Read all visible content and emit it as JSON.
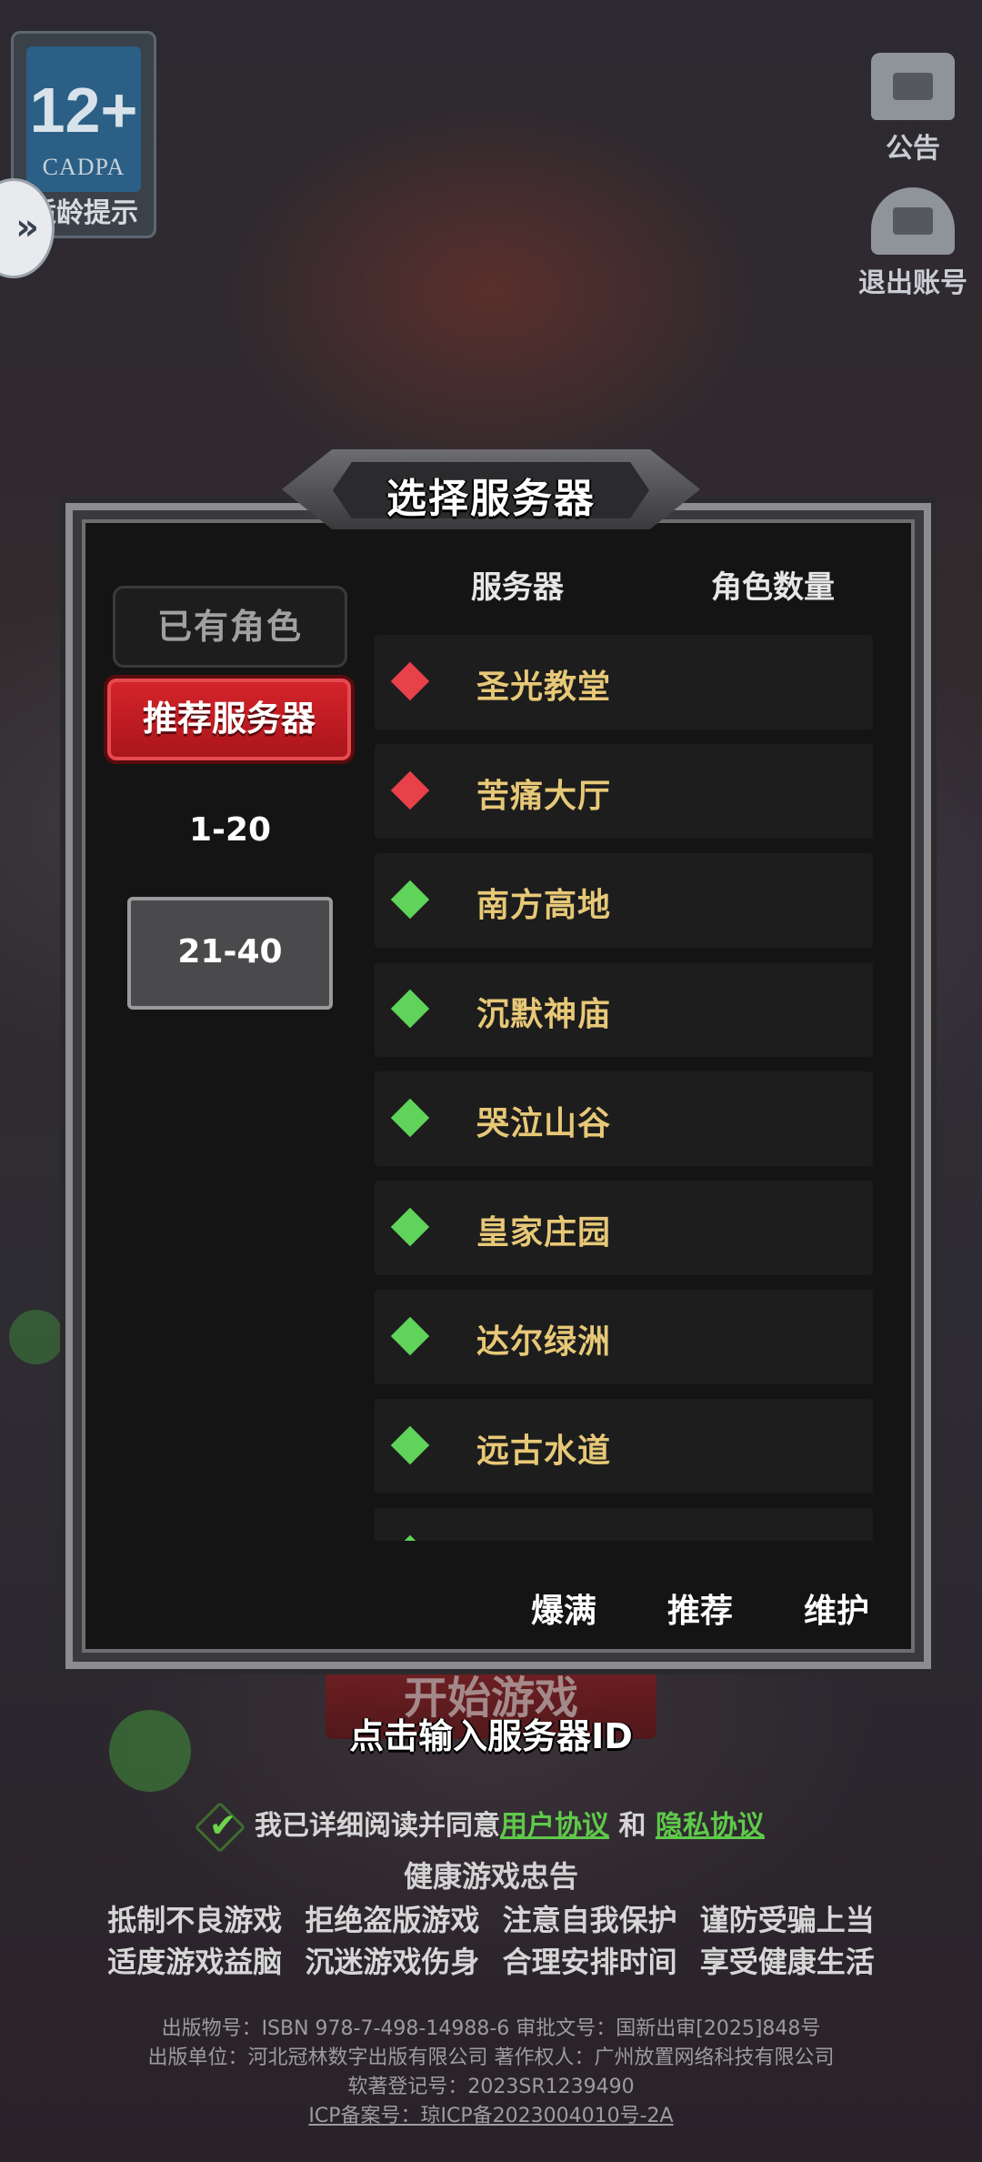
{
  "age_rating": {
    "number": "12+",
    "org": "CADPA",
    "caption": "适龄提示"
  },
  "side_handle_icon": "double-chevron-right-icon",
  "top_right": [
    {
      "label": "公告",
      "icon": "announcement-icon"
    },
    {
      "label": "退出账号",
      "icon": "logout-icon"
    }
  ],
  "dialog": {
    "title": "选择服务器",
    "columns": {
      "server": "服务器",
      "roles": "角色数量"
    },
    "tabs": {
      "owned": "已有角色",
      "recommended": "推荐服务器"
    },
    "ranges": [
      "1-20",
      "21-40"
    ],
    "servers": [
      {
        "name": "圣光教堂",
        "status": "red"
      },
      {
        "name": "苦痛大厅",
        "status": "red"
      },
      {
        "name": "南方高地",
        "status": "green"
      },
      {
        "name": "沉默神庙",
        "status": "green"
      },
      {
        "name": "哭泣山谷",
        "status": "green"
      },
      {
        "name": "皇家庄园",
        "status": "green"
      },
      {
        "name": "达尔绿洲",
        "status": "green"
      },
      {
        "name": "远古水道",
        "status": "green"
      }
    ],
    "legend": [
      "爆满",
      "推荐",
      "维护"
    ]
  },
  "colors": {
    "red_status": "#e8414a",
    "green_status": "#5fd35a",
    "server_name": "#e7c877",
    "accent_red": "#c51c22"
  },
  "start_button": "开始游戏",
  "input_server_id": "点击输入服务器ID",
  "agreement": {
    "prefix": "我已详细阅读并同意",
    "user_agreement": "用户协议",
    "and": "和",
    "privacy": "隐私协议"
  },
  "health": {
    "title": "健康游戏忠告",
    "line1": "抵制不良游戏 拒绝盗版游戏 注意自我保护 谨防受骗上当",
    "line2": "适度游戏益脑 沉迷游戏伤身 合理安排时间 享受健康生活"
  },
  "legal": {
    "line1": "出版物号：ISBN 978-7-498-14988-6 审批文号：国新出审[2025]848号",
    "line2": "出版单位：河北冠林数字出版有限公司 著作权人：广州放置网络科技有限公司",
    "line3": "软著登记号：2023SR1239490",
    "line4": "ICP备案号：琼ICP备2023004010号-2A"
  }
}
